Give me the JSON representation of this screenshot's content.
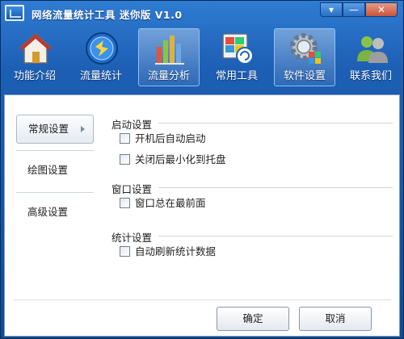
{
  "window": {
    "title": "网络流量统计工具 迷你版 V1.0"
  },
  "titlebar_buttons": {
    "menu": "▾",
    "minimize": "—",
    "close": "✕"
  },
  "toolbar": [
    {
      "label": "功能介绍",
      "icon": "home-icon",
      "active": false
    },
    {
      "label": "流量统计",
      "icon": "globe-icon",
      "active": false
    },
    {
      "label": "流量分析",
      "icon": "bar-chart-icon",
      "active": true
    },
    {
      "label": "常用工具",
      "icon": "refresh-window-icon",
      "active": false
    },
    {
      "label": "软件设置",
      "icon": "settings-gear-icon",
      "active": true
    },
    {
      "label": "联系我们",
      "icon": "contacts-icon",
      "active": false
    }
  ],
  "sidebar": [
    {
      "label": "常规设置",
      "active": true
    },
    {
      "label": "绘图设置",
      "active": false
    },
    {
      "label": "高级设置",
      "active": false
    }
  ],
  "sections": {
    "startup": {
      "title": "启动设置",
      "options": [
        {
          "label": "开机后自动启动",
          "checked": false
        },
        {
          "label": "关闭后最小化到托盘",
          "checked": false
        }
      ]
    },
    "window": {
      "title": "窗口设置",
      "options": [
        {
          "label": "窗口总在最前面",
          "checked": false
        }
      ]
    },
    "stats": {
      "title": "统计设置",
      "options": [
        {
          "label": "自动刷新统计数据",
          "checked": false
        }
      ]
    }
  },
  "buttons": {
    "ok": "确定",
    "cancel": "取消"
  },
  "colors": {
    "titlebar": "#1d5fb4",
    "accent": "#2f7cd3",
    "content_bg": "#ffffff"
  }
}
